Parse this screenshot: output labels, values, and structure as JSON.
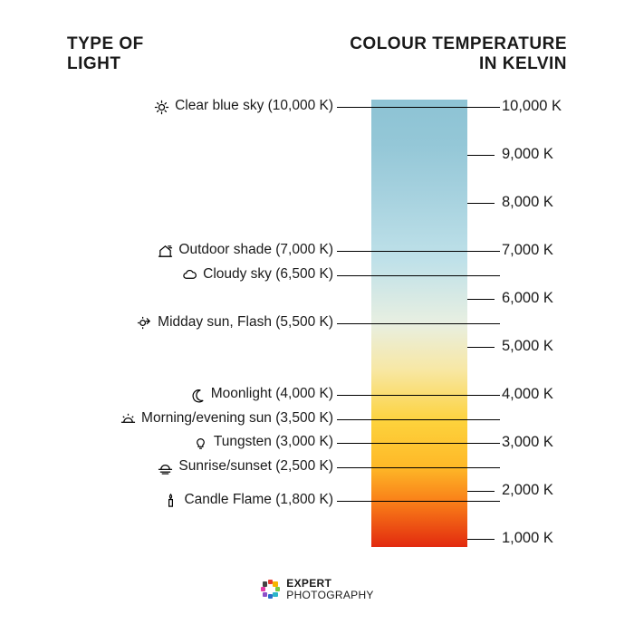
{
  "headers": {
    "left_line1": "TYPE OF",
    "left_line2": "LIGHT",
    "right_line1": "COLOUR TEMPERATURE",
    "right_line2": "IN KELVIN"
  },
  "chart_data": {
    "type": "bar",
    "title": "Colour temperature in Kelvin",
    "ylabel": "Kelvin",
    "ylim": [
      1000,
      10000
    ],
    "ticks": [
      {
        "k": 10000,
        "label": "10,000 K"
      },
      {
        "k": 9000,
        "label": "9,000 K"
      },
      {
        "k": 8000,
        "label": "8,000 K"
      },
      {
        "k": 7000,
        "label": "7,000 K"
      },
      {
        "k": 6000,
        "label": "6,000 K"
      },
      {
        "k": 5000,
        "label": "5,000 K"
      },
      {
        "k": 4000,
        "label": "4,000 K"
      },
      {
        "k": 3000,
        "label": "3,000 K"
      },
      {
        "k": 2000,
        "label": "2,000 K"
      },
      {
        "k": 1000,
        "label": "1,000 K"
      }
    ],
    "lights": [
      {
        "k": 10000,
        "label": "Clear blue sky (10,000 K)",
        "icon": "sun-icon"
      },
      {
        "k": 7000,
        "label": "Outdoor shade (7,000 K)",
        "icon": "house-shade-icon"
      },
      {
        "k": 6500,
        "label": "Cloudy sky (6,500 K)",
        "icon": "cloud-icon"
      },
      {
        "k": 5500,
        "label": "Midday sun, Flash (5,500 K)",
        "icon": "sun-flash-icon"
      },
      {
        "k": 4000,
        "label": "Moonlight (4,000 K)",
        "icon": "moon-icon"
      },
      {
        "k": 3500,
        "label": "Morning/evening sun (3,500 K)",
        "icon": "sun-horizon-icon"
      },
      {
        "k": 3000,
        "label": "Tungsten (3,000 K)",
        "icon": "bulb-icon"
      },
      {
        "k": 2500,
        "label": "Sunrise/sunset (2,500 K)",
        "icon": "sunset-icon"
      },
      {
        "k": 1800,
        "label": "Candle Flame (1,800 K)",
        "icon": "candle-icon"
      }
    ],
    "gradient_stops": [
      {
        "k": 10000,
        "color": "#8dc3d4"
      },
      {
        "k": 7000,
        "color": "#a7d2df"
      },
      {
        "k": 5500,
        "color": "#e8efe1"
      },
      {
        "k": 4000,
        "color": "#fdd23c"
      },
      {
        "k": 2500,
        "color": "#f97e18"
      },
      {
        "k": 1000,
        "color": "#e22a0f"
      }
    ]
  },
  "footer": {
    "brand_bold": "EXPERT",
    "brand_rest": "PHOTOGRAPHY",
    "logo_colors": [
      "#e63b2e",
      "#f7b500",
      "#7ac943",
      "#2cb6c9",
      "#2c6fc9",
      "#8e4fc9",
      "#e63ba8",
      "#444"
    ]
  }
}
